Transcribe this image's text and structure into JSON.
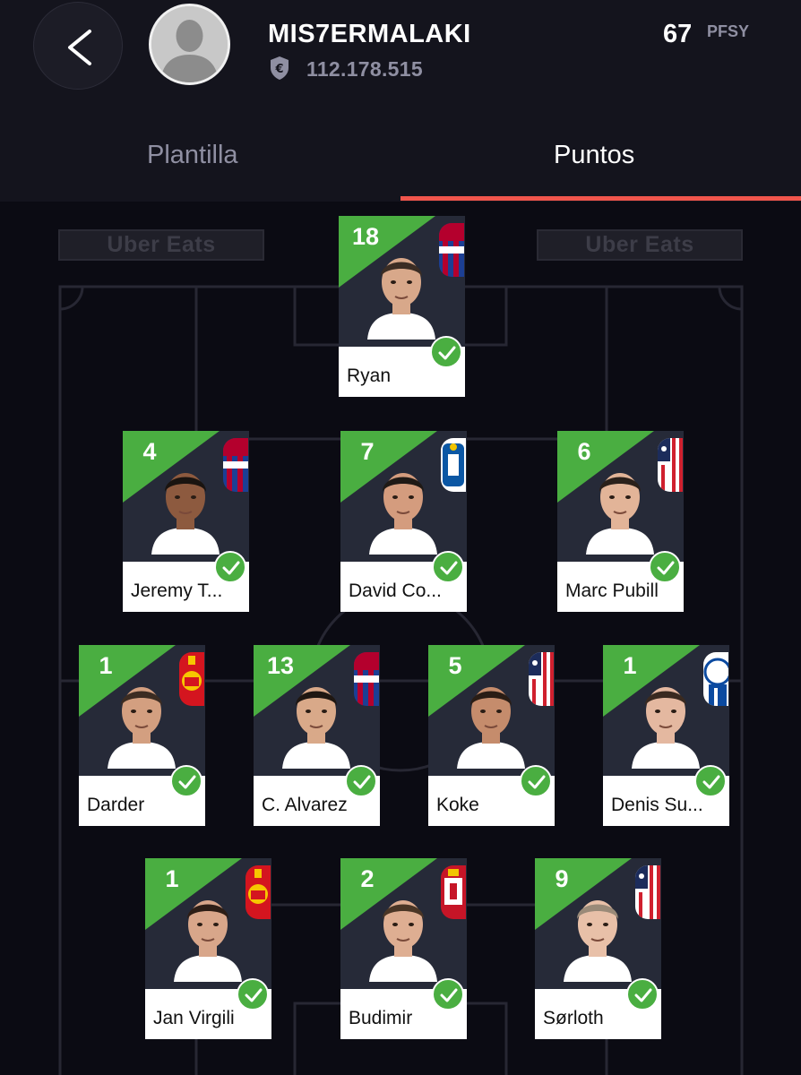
{
  "header": {
    "back_icon": "chevron-left-icon",
    "avatar_icon": "user-silhouette-icon",
    "username": "MIS7ERMALAKI",
    "money_icon": "euro-shield-icon",
    "money": "112.178.515",
    "points": "67",
    "points_unit": "PFSY"
  },
  "tabs": [
    {
      "label": "Plantilla",
      "active": false
    },
    {
      "label": "Puntos",
      "active": true
    }
  ],
  "ads": [
    "Uber Eats",
    "Uber Eats"
  ],
  "colors": {
    "accent_green": "#4aae41",
    "tab_underline": "#f1554c",
    "header_bg": "#14141d",
    "pitch_bg": "#0b0b13"
  },
  "players": [
    {
      "name": "Ryan",
      "points": "18",
      "crest": "levante"
    },
    {
      "name": "Jeremy T...",
      "points": "4",
      "crest": "levante"
    },
    {
      "name": "David Co...",
      "points": "7",
      "crest": "oviedo"
    },
    {
      "name": "Marc Pubill",
      "points": "6",
      "crest": "atletico"
    },
    {
      "name": "Darder",
      "points": "1",
      "crest": "mallorca"
    },
    {
      "name": "C. Alvarez",
      "points": "13",
      "crest": "levante"
    },
    {
      "name": "Koke",
      "points": "5",
      "crest": "atletico"
    },
    {
      "name": "Denis Su...",
      "points": "1",
      "crest": "alaves"
    },
    {
      "name": "Jan Virgili",
      "points": "1",
      "crest": "mallorca"
    },
    {
      "name": "Budimir",
      "points": "2",
      "crest": "osasuna"
    },
    {
      "name": "Sørloth",
      "points": "9",
      "crest": "atletico"
    }
  ]
}
